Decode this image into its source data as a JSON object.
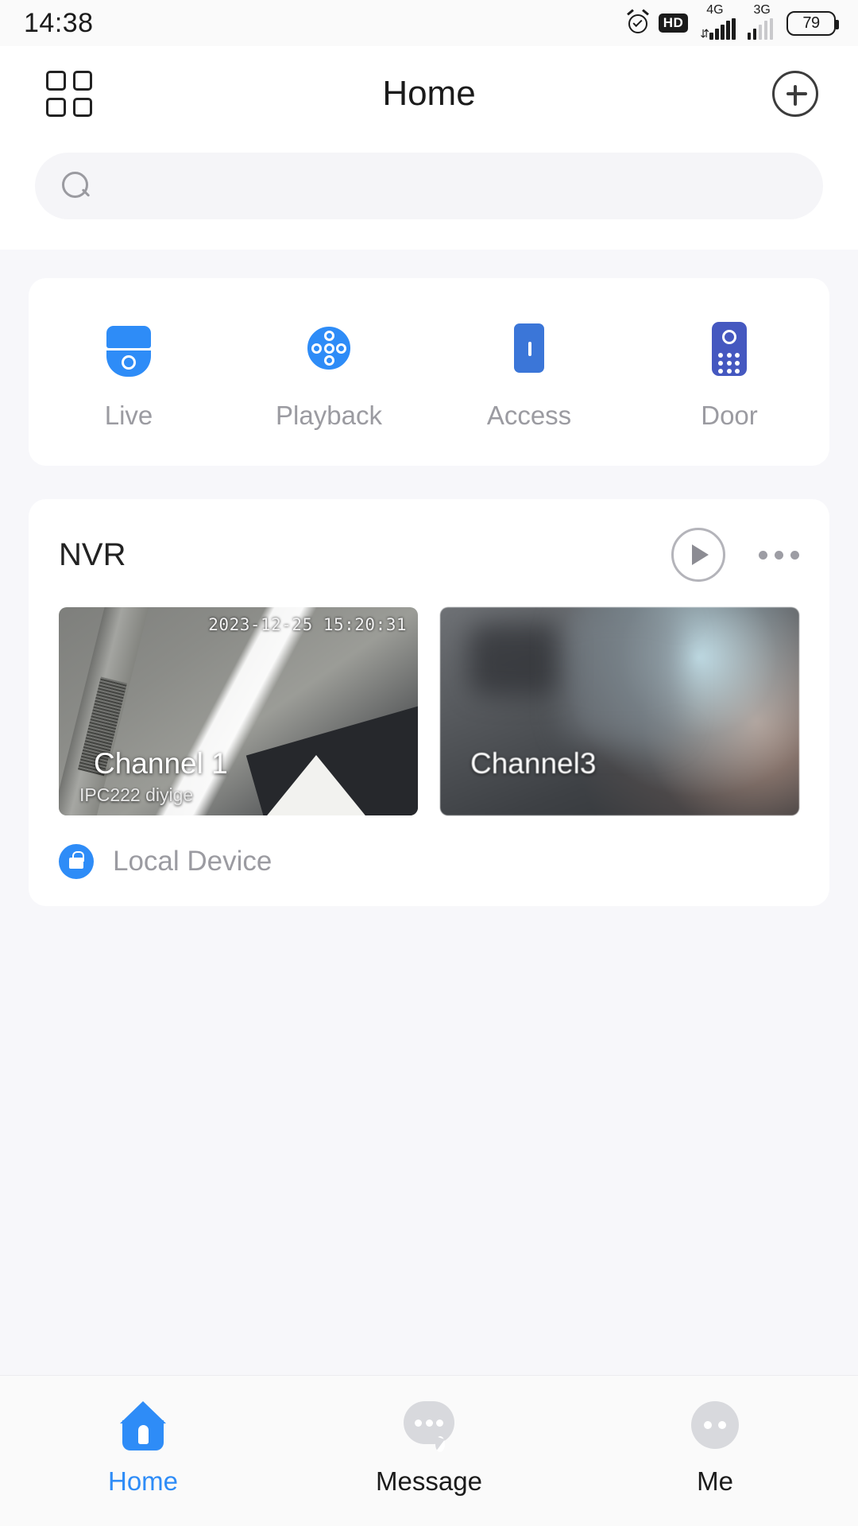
{
  "status_bar": {
    "time": "14:38",
    "alarm_icon": "alarm-clock-icon",
    "hd_badge": "HD",
    "network_primary": "4G",
    "network_secondary": "3G",
    "battery_level": "79"
  },
  "header": {
    "grid_icon": "grid-menu-icon",
    "title": "Home",
    "add_icon": "plus-circle-icon"
  },
  "search": {
    "icon": "search-icon",
    "value": "",
    "placeholder": ""
  },
  "shortcuts": [
    {
      "label": "Live",
      "icon": "dome-camera-icon",
      "color": "#2e8cf7"
    },
    {
      "label": "Playback",
      "icon": "disc-playback-icon",
      "color": "#2e8cf7"
    },
    {
      "label": "Access",
      "icon": "access-panel-icon",
      "color": "#3b76d8"
    },
    {
      "label": "Door",
      "icon": "intercom-door-icon",
      "color": "#4558c0"
    }
  ],
  "device_group": {
    "title": "NVR",
    "play_icon": "play-circle-icon",
    "more_icon": "more-horizontal-icon",
    "channels": [
      {
        "name": "Channel 1",
        "subtitle": "IPC222 diyige",
        "timestamp": "2023-12-25 15:20:31"
      },
      {
        "name": "Channel3",
        "subtitle": "",
        "timestamp": ""
      }
    ],
    "footer": {
      "icon": "lock-badge-icon",
      "label": "Local Device"
    }
  },
  "tabbar": [
    {
      "label": "Home",
      "icon": "home-icon",
      "active": true
    },
    {
      "label": "Message",
      "icon": "message-icon",
      "active": false
    },
    {
      "label": "Me",
      "icon": "profile-icon",
      "active": false
    }
  ],
  "colors": {
    "accent": "#2e8cf7",
    "page_bg": "#f7f7fa",
    "card_bg": "#ffffff",
    "muted_text": "#9b9ba1"
  }
}
